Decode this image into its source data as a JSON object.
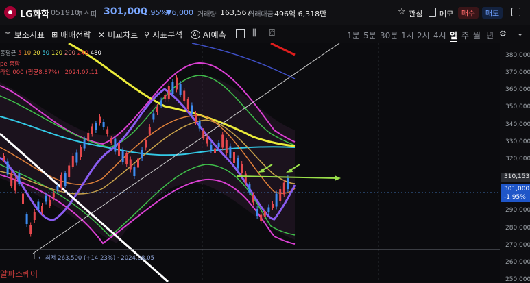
{
  "header": {
    "stock_name": "LG화학",
    "stock_code": "051910",
    "market": "코스피",
    "price": "301,000",
    "change_pct": "-1.95%",
    "change_amount": "▼6,000",
    "volume_label": "거래량",
    "volume": "163,567",
    "amount_label": "거래대금",
    "amount": "496억 6,318만",
    "watch_label": "관심",
    "memo_label": "메모",
    "buy_label": "매수",
    "sell_label": "매도"
  },
  "toolbar": {
    "indicators": "보조지표",
    "strategy": "매매전략",
    "compare": "비교차트",
    "analysis": "지표분석",
    "ai": "AI예측",
    "periods": [
      "1분",
      "5분",
      "30분",
      "1시",
      "2시",
      "4시",
      "일",
      "주",
      "월",
      "년"
    ],
    "active_period": "일"
  },
  "legend": {
    "ma_line_label": "동평균",
    "ma_periods": [
      "5",
      "10",
      "20",
      "50",
      "120",
      "200",
      "240",
      "480"
    ],
    "ma_colors": [
      "#e84040",
      "#f0a830",
      "#f0e040",
      "#40d8f0",
      "#f0f040",
      "#f08080",
      "#f03030",
      "#ffffff"
    ],
    "line2": "pe 종합",
    "line3": "라인 000 (평균8.87%) · 2024.07.11"
  },
  "annotations": {
    "low_label": "최저 263,500 (+14.23%) · 2024.08.05",
    "watermark": "알파스퀘어"
  },
  "yaxis": {
    "ticks": [
      "380,000",
      "370,000",
      "360,000",
      "350,000",
      "340,000",
      "330,000",
      "320,000",
      "310,000",
      "300,000",
      "290,000",
      "280,000",
      "270,000",
      "260,000",
      "250,000"
    ],
    "line_tag": "310,153",
    "price_tag": "301,000",
    "price_tag_pct": "-1.95%"
  },
  "colors": {
    "up": "#e5484d",
    "down": "#3d8cf0",
    "accent_price": "#7aa7ff"
  }
}
